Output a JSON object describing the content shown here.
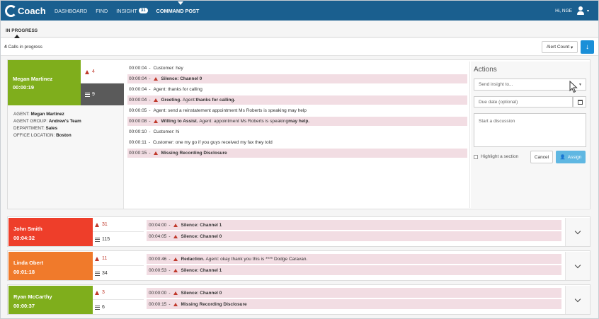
{
  "nav": {
    "logo_text": "Coach",
    "items": [
      {
        "label": "DASHBOARD"
      },
      {
        "label": "FIND"
      },
      {
        "label": "INSIGHT",
        "badge": "31"
      },
      {
        "label": "COMMAND POST"
      }
    ],
    "user_label": "Hi, NGE",
    "accent_color": "#1a5f8f"
  },
  "subtabs": {
    "active": "IN PROGRESS"
  },
  "calls": {
    "count": "4",
    "label": "Calls in progress"
  },
  "toolbar": {
    "alert_count_label": "Alert Count",
    "alert_caret": "▾",
    "download_icon": "↓"
  },
  "expanded_call": {
    "agent_name": "Megan Martinez",
    "duration": "00:00:19",
    "color": "#7fae1c",
    "alert_count": "4",
    "line_count": "9",
    "info": [
      {
        "key": "AGENT:",
        "value": "Megan Martinez"
      },
      {
        "key": "AGENT GROUP:",
        "value": "Andrew's Team"
      },
      {
        "key": "DEPARTMENT:",
        "value": "Sales"
      },
      {
        "key": "OFFICE LOCATION:",
        "value": "Boston"
      }
    ],
    "transcript": [
      {
        "time": "00:00:04",
        "alert": false,
        "label": "",
        "text": "Customer: hey",
        "bold_tail": ""
      },
      {
        "time": "00:00:04",
        "alert": true,
        "label": "Silence: Channel 0",
        "text": "",
        "bold_tail": ""
      },
      {
        "time": "00:00:04",
        "alert": false,
        "label": "",
        "text": "Agent: thanks for calling",
        "bold_tail": ""
      },
      {
        "time": "00:00:04",
        "alert": true,
        "label": "Greeting.",
        "text": "Agent: ",
        "bold_tail": "thanks for calling."
      },
      {
        "time": "00:00:05",
        "alert": false,
        "label": "",
        "text": "Agent: send a reinstatement appointment Ms Roberts is speaking may help",
        "bold_tail": ""
      },
      {
        "time": "00:00:08",
        "alert": true,
        "label": "Willing to Assist.",
        "text": "Agent: appointment Ms Roberts is speaking ",
        "bold_tail": "may help."
      },
      {
        "time": "00:00:10",
        "alert": false,
        "label": "",
        "text": "Customer: hi",
        "bold_tail": ""
      },
      {
        "time": "00:00:11",
        "alert": false,
        "label": "",
        "text": "Customer: one my go if you guys received my fax they told",
        "bold_tail": ""
      },
      {
        "time": "00:00:15",
        "alert": true,
        "label": "Missing Recording Disclosure",
        "text": "",
        "bold_tail": ""
      }
    ]
  },
  "actions": {
    "title": "Actions",
    "send_placeholder": "Send insight to...",
    "due_placeholder": "Due date (optional)",
    "discussion_placeholder": "Start a discussion",
    "highlight_label": "Highlight a section",
    "cancel_label": "Cancel",
    "assign_label": "Assign",
    "assign_color": "#5fb7e2"
  },
  "collapsed_calls": [
    {
      "agent_name": "John Smith",
      "duration": "00:04:32",
      "color": "#ee3e2a",
      "alert_count": "31",
      "line_count": "115",
      "lines": [
        {
          "time": "00:04:00",
          "label": "Silence: Channel 1",
          "text": ""
        },
        {
          "time": "00:04:05",
          "label": "Silence: Channel 0",
          "text": ""
        }
      ]
    },
    {
      "agent_name": "Linda Obert",
      "duration": "00:01:18",
      "color": "#f07a2b",
      "alert_count": "11",
      "line_count": "34",
      "lines": [
        {
          "time": "00:00:46",
          "label": "Redaction.",
          "text": "Agent: okay thank you this is **** Dodge Caravan."
        },
        {
          "time": "00:00:53",
          "label": "Silence: Channel 1",
          "text": ""
        }
      ]
    },
    {
      "agent_name": "Ryan McCarthy",
      "duration": "00:00:37",
      "color": "#7fae1c",
      "alert_count": "3",
      "line_count": "6",
      "lines": [
        {
          "time": "00:00:00",
          "label": "Silence: Channel 0",
          "text": ""
        },
        {
          "time": "00:00:15",
          "label": "Missing Recording Disclosure",
          "text": ""
        }
      ]
    }
  ]
}
